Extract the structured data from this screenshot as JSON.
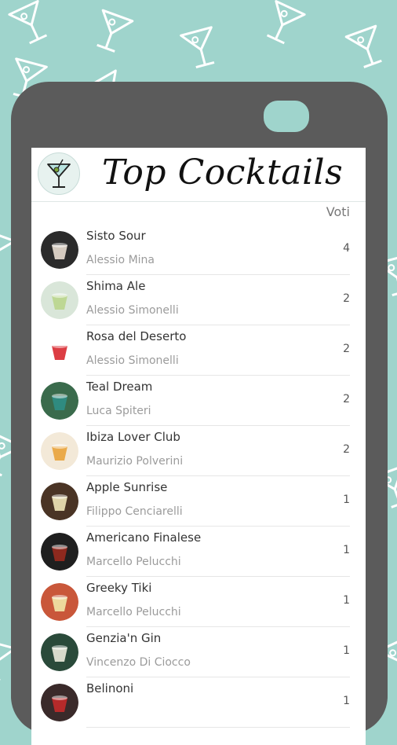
{
  "app": {
    "title": "Top Cocktails",
    "votes_label": "Voti",
    "logo_icon": "cocktail-glass-icon",
    "colors": {
      "background": "#9fd4cc",
      "phone_frame": "#5b5b5b",
      "screen": "#ffffff"
    }
  },
  "cocktails": [
    {
      "name": "Sisto Sour",
      "author": "Alessio Mina",
      "votes": "4",
      "thumb": [
        "#2b2b2b",
        "#e8ddd0"
      ]
    },
    {
      "name": "Shima Ale",
      "author": "Alessio Simonelli",
      "votes": "2",
      "thumb": [
        "#d9e6d9",
        "#b9d58c"
      ]
    },
    {
      "name": "Rosa del Deserto",
      "author": "Alessio Simonelli",
      "votes": "2",
      "thumb": [
        "#ffffff",
        "#d8282f"
      ]
    },
    {
      "name": "Teal Dream",
      "author": "Luca Spiteri",
      "votes": "2",
      "thumb": [
        "#3a6b4c",
        "#2f8f86"
      ]
    },
    {
      "name": "Ibiza Lover Club",
      "author": "Maurizio Polverini",
      "votes": "2",
      "thumb": [
        "#f3e9d8",
        "#e9a33b"
      ]
    },
    {
      "name": "Apple Sunrise",
      "author": "Filippo Cenciarelli",
      "votes": "1",
      "thumb": [
        "#4a3425",
        "#efe6b8"
      ]
    },
    {
      "name": "Americano Finalese",
      "author": "Marcello Pelucchi",
      "votes": "1",
      "thumb": [
        "#1f1f1f",
        "#9a2a1e"
      ]
    },
    {
      "name": "Greeky Tiki",
      "author": "Marcello Pelucchi",
      "votes": "1",
      "thumb": [
        "#c9573a",
        "#f1e7a8"
      ]
    },
    {
      "name": "Genzia'n Gin",
      "author": "Vincenzo Di Ciocco",
      "votes": "1",
      "thumb": [
        "#2a4a3a",
        "#eaeadc"
      ]
    },
    {
      "name": "Belinoni",
      "author": "",
      "votes": "1",
      "thumb": [
        "#3a2a2a",
        "#c42a2a"
      ]
    }
  ]
}
